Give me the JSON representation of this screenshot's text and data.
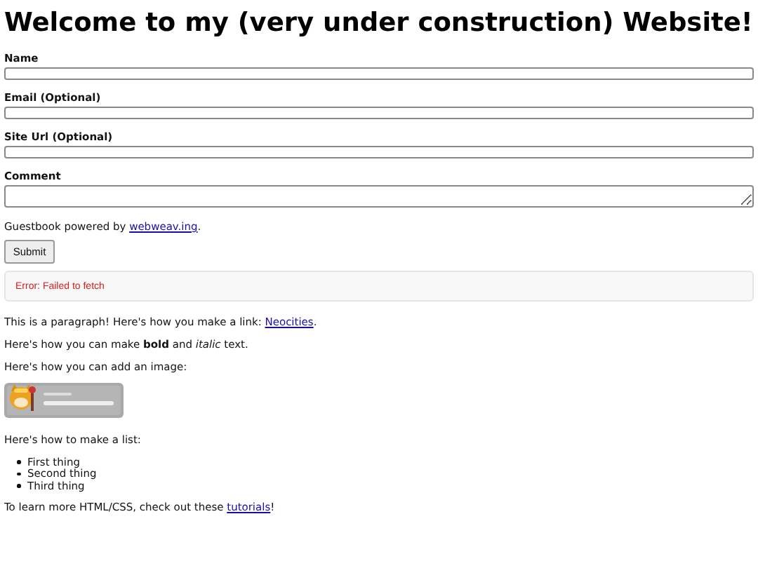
{
  "heading": "Welcome to my (very under construction) Website!",
  "form": {
    "fields": [
      {
        "label": "Name",
        "kind": "input"
      },
      {
        "label": "Email (Optional)",
        "kind": "input"
      },
      {
        "label": "Site Url (Optional)",
        "kind": "input"
      },
      {
        "label": "Comment",
        "kind": "textarea"
      }
    ],
    "powered_by": {
      "before": "Guestbook powered by ",
      "link": "webweav.ing",
      "after": "."
    },
    "submit": "Submit",
    "error": "Error: Failed to fetch"
  },
  "content": [
    {
      "kind": "paragraph",
      "before": "This is a paragraph! Here's how you make a link: ",
      "link": "Neocities",
      "after": "."
    },
    {
      "kind": "paragraph",
      "text": "Here's how you can make **bold** and *italic* text."
    },
    {
      "kind": "paragraph",
      "text": "Here's how you can add an image:"
    },
    {
      "kind": "picture"
    },
    {
      "kind": "paragraph",
      "text": "Here's how to make a list:"
    },
    {
      "kind": "list",
      "items": [
        "First thing",
        "Second thing",
        "Third thing"
      ]
    },
    {
      "kind": "paragraph",
      "before": "To learn more HTML/CSS, check out these ",
      "link": "tutorials",
      "after": "!"
    }
  ]
}
